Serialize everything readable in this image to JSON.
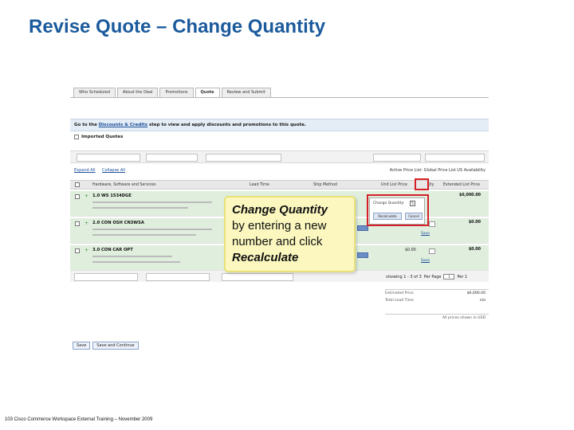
{
  "slide": {
    "title": "Revise Quote – Change Quantity",
    "footer": "103 Cisco Commerce Workspace External Training – November 2009"
  },
  "tabs": [
    {
      "label": "Who Scheduled"
    },
    {
      "label": "About the Deal"
    },
    {
      "label": "Promotions"
    },
    {
      "label": "Quote",
      "active": true
    },
    {
      "label": "Review and Submit"
    }
  ],
  "banner": {
    "prefix": "Go to the ",
    "link": "Discounts & Credits",
    "suffix": " step to view and apply discounts and promotions to this quote."
  },
  "imported_quotes": "Imported Quotes",
  "links": {
    "expand_all": "Expand All",
    "collapse_all": "Collapse All",
    "availability": "Active Price List: Global Price List US Availability"
  },
  "table": {
    "headers": {
      "product": "Hardware, Software and Services",
      "lead_time": "Lead Time",
      "ship": "Ship Method",
      "unit_price": "Unit List Price",
      "qty": "Qty",
      "ext_price": "Extended List Price"
    },
    "rows": [
      {
        "line1": "1.0 WS 1534DGE",
        "ext": "$6,000.00"
      },
      {
        "line1": "2.0 CON OSH CN3WSA",
        "ext": "$0.00"
      },
      {
        "line1": "3.0 CON CAR OPT",
        "ext": "$0.00"
      }
    ],
    "row_unit": "$0.00",
    "save": "Save"
  },
  "qty_popup": {
    "label": "Change Quantity:",
    "value": "5",
    "recalc": "Recalculate",
    "cancel": "Cancel"
  },
  "pager": {
    "text": "showing 1 - 3 of 3",
    "per_page": "Per Page",
    "page_value": "1",
    "page_label": "Per 1"
  },
  "totals": [
    {
      "label": "Estimated Price",
      "value": "$6,000.00"
    },
    {
      "label": "Total Lead Time",
      "value": "n/a"
    }
  ],
  "totals_note": "All prices shown in USD",
  "bottom_buttons": {
    "save": "Save",
    "save_continue": "Save and Continue"
  },
  "callout": {
    "line1": "Change Quantity",
    "line2": "by entering a new",
    "line3": "number and click",
    "line4": "Recalculate"
  }
}
